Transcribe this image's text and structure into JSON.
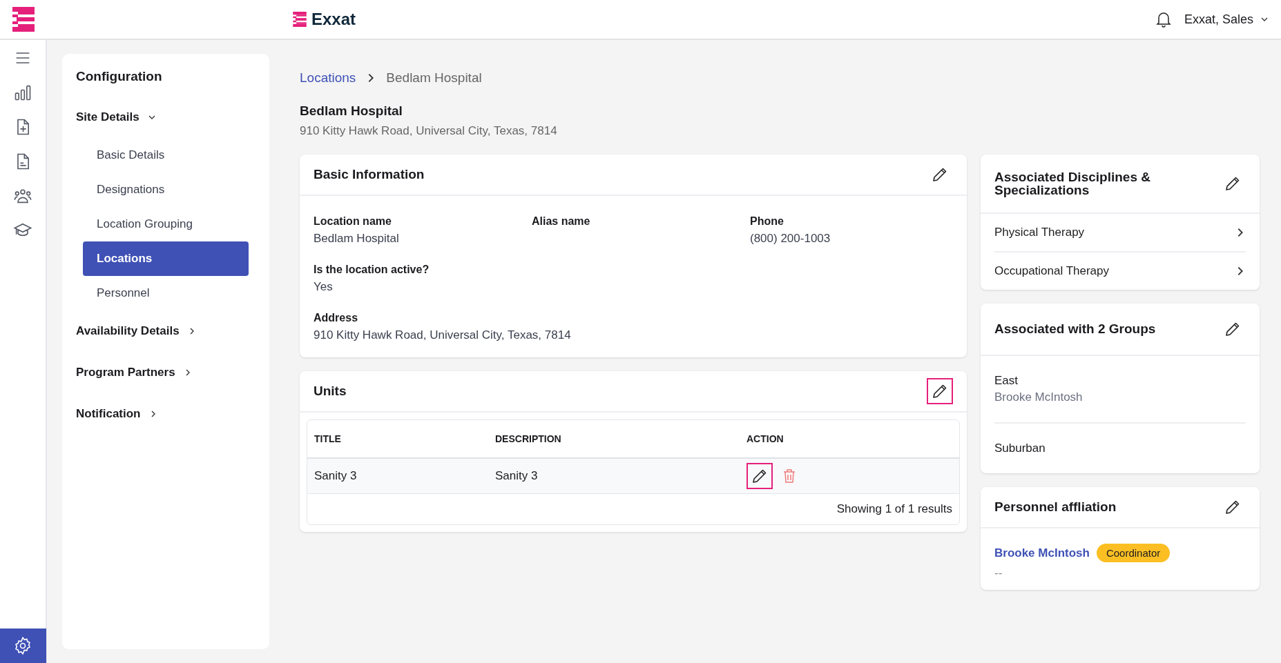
{
  "header": {
    "brand": "Exxat",
    "user": "Exxat, Sales"
  },
  "rail": {
    "items": [
      {
        "kind": "menu",
        "selected": false
      },
      {
        "kind": "chart",
        "selected": false
      },
      {
        "kind": "doc-add",
        "selected": false
      },
      {
        "kind": "doc",
        "selected": false
      },
      {
        "kind": "people",
        "selected": false
      },
      {
        "kind": "cap",
        "selected": false
      }
    ],
    "settings_selected": true
  },
  "config": {
    "title": "Configuration",
    "sections": [
      {
        "label": "Site Details",
        "expanded": true,
        "items": [
          {
            "label": "Basic Details",
            "selected": false
          },
          {
            "label": "Designations",
            "selected": false
          },
          {
            "label": "Location Grouping",
            "selected": false
          },
          {
            "label": "Locations",
            "selected": true
          },
          {
            "label": "Personnel",
            "selected": false
          }
        ]
      },
      {
        "label": "Availability Details",
        "expanded": false
      },
      {
        "label": "Program Partners",
        "expanded": false
      },
      {
        "label": "Notification",
        "expanded": false
      }
    ]
  },
  "breadcrumb": {
    "link": "Locations",
    "current": "Bedlam Hospital"
  },
  "page": {
    "title": "Bedlam Hospital",
    "subtitle": "910 Kitty Hawk Road, Universal City, Texas, 7814"
  },
  "basic_info": {
    "title": "Basic Information",
    "fields": [
      {
        "label": "Location name",
        "value": "Bedlam Hospital",
        "full": false
      },
      {
        "label": "Alias name",
        "full": false
      },
      {
        "label": "Phone",
        "value": "(800) 200-1003",
        "full": false
      },
      {
        "label": "Is the location active?",
        "value": "Yes",
        "full": true
      },
      {
        "label": "Address",
        "value": "910 Kitty Hawk Road, Universal City, Texas, 7814",
        "full": true
      }
    ]
  },
  "units": {
    "title": "Units",
    "edit_highlighted": true,
    "columns": [
      "TITLE",
      "DESCRIPTION",
      "ACTION"
    ],
    "rows": [
      {
        "title": "Sanity 3",
        "description": "Sanity 3",
        "edit_highlighted": true
      }
    ],
    "footer": "Showing 1 of 1 results"
  },
  "disciplines": {
    "title": "Associated Disciplines & Specializations",
    "items": [
      "Physical Therapy",
      "Occupational Therapy"
    ]
  },
  "groups": {
    "title": "Associated with 2 Groups",
    "items": [
      {
        "name": "East",
        "person": "Brooke McIntosh"
      },
      {
        "name": "Suburban"
      }
    ]
  },
  "personnel": {
    "title": "Personnel affliation",
    "items": [
      {
        "name": "Brooke McIntosh",
        "role": "Coordinator",
        "detail": "--"
      }
    ]
  }
}
